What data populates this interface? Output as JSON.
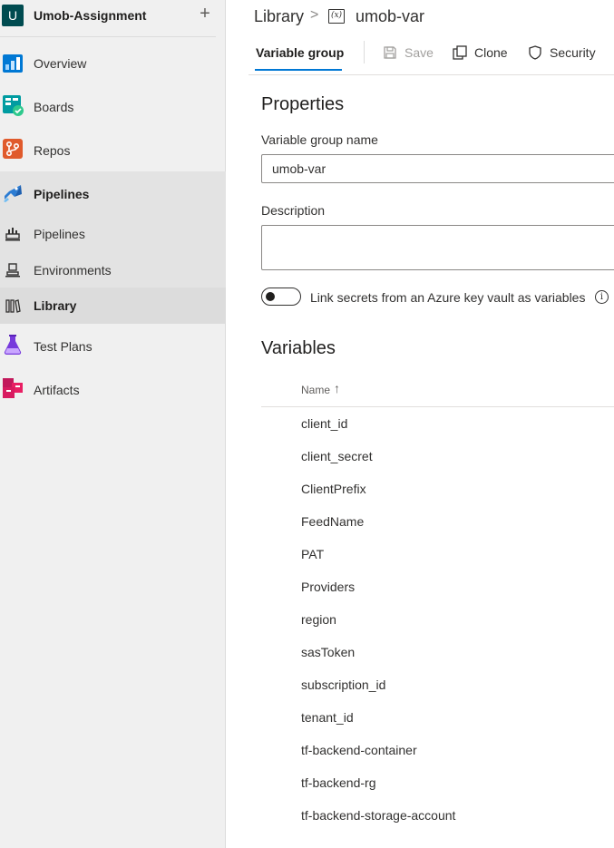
{
  "project": {
    "initial": "U",
    "name": "Umob-Assignment",
    "add_icon": "plus-icon"
  },
  "nav": [
    {
      "label": "Overview",
      "icon": "overview-icon"
    },
    {
      "label": "Boards",
      "icon": "boards-icon"
    },
    {
      "label": "Repos",
      "icon": "repos-icon"
    },
    {
      "label": "Pipelines",
      "icon": "pipelines-icon"
    },
    {
      "label": "Pipelines",
      "icon": "pipelines-sub-icon"
    },
    {
      "label": "Environments",
      "icon": "environments-icon"
    },
    {
      "label": "Library",
      "icon": "library-icon"
    },
    {
      "label": "Test Plans",
      "icon": "test-plans-icon"
    },
    {
      "label": "Artifacts",
      "icon": "artifacts-icon"
    }
  ],
  "breadcrumb": {
    "root": "Library",
    "separator": ">",
    "icon_text": "(x)",
    "current": "umob-var"
  },
  "toolbar": {
    "tab": "Variable group",
    "save": "Save",
    "clone": "Clone",
    "security": "Security"
  },
  "properties": {
    "title": "Properties",
    "name_label": "Variable group name",
    "name_value": "umob-var",
    "description_label": "Description",
    "description_value": "",
    "toggle_label": "Link secrets from an Azure key vault as variables",
    "info_icon_text": "i"
  },
  "variables": {
    "title": "Variables",
    "column_name": "Name",
    "sort_indicator": "↑",
    "rows": [
      "client_id",
      "client_secret",
      "ClientPrefix",
      "FeedName",
      "PAT",
      "Providers",
      "region",
      "sasToken",
      "subscription_id",
      "tenant_id",
      "tf-backend-container",
      "tf-backend-rg",
      "tf-backend-storage-account"
    ]
  },
  "colors": {
    "accent": "#0078d4",
    "sidebar_bg": "#f0f0f0",
    "selected_bg": "#dcdcdc",
    "project_avatar": "#004b50"
  }
}
